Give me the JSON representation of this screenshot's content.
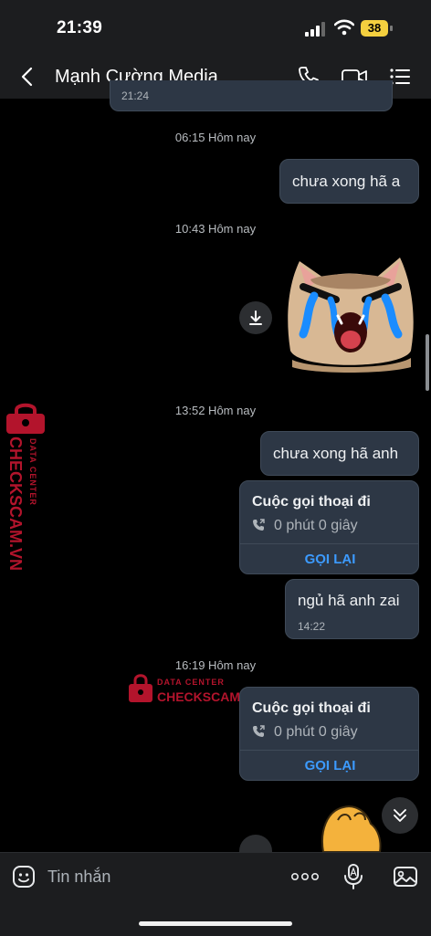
{
  "status_bar": {
    "time": "21:39",
    "battery": "38"
  },
  "header": {
    "title": "Mạnh Cường Media"
  },
  "messages": {
    "prev_time": "21:24",
    "ts1": "06:15 Hôm nay",
    "m1": "chưa xong hã a",
    "ts2": "10:43 Hôm nay",
    "ts3": "13:52 Hôm nay",
    "m2": "chưa xong hã anh",
    "call1": {
      "title": "Cuộc gọi thoại đi",
      "duration": "0 phút 0 giây",
      "action": "GỌI LẠI"
    },
    "m3": "ngủ hã anh zai",
    "m3_time": "14:22",
    "ts4": "16:19 Hôm nay",
    "call2": {
      "title": "Cuộc gọi thoại đi",
      "duration": "0 phút 0 giây",
      "action": "GỌI LẠI"
    }
  },
  "watermark": {
    "line1": "DATA CENTER",
    "line2": "CHECKSCAM.VN"
  },
  "composer": {
    "placeholder": "Tin nhắn"
  },
  "colors": {
    "bubble": "#2d3745",
    "accent": "#3c9bff",
    "watermark": "#b3142c"
  },
  "icons": [
    "chevron-left-icon",
    "phone-icon",
    "video-icon",
    "list-icon",
    "download-icon",
    "sticker-icon",
    "more-icon",
    "mic-icon",
    "image-icon",
    "chevron-double-down-icon",
    "phone-out-icon",
    "lock-icon"
  ]
}
